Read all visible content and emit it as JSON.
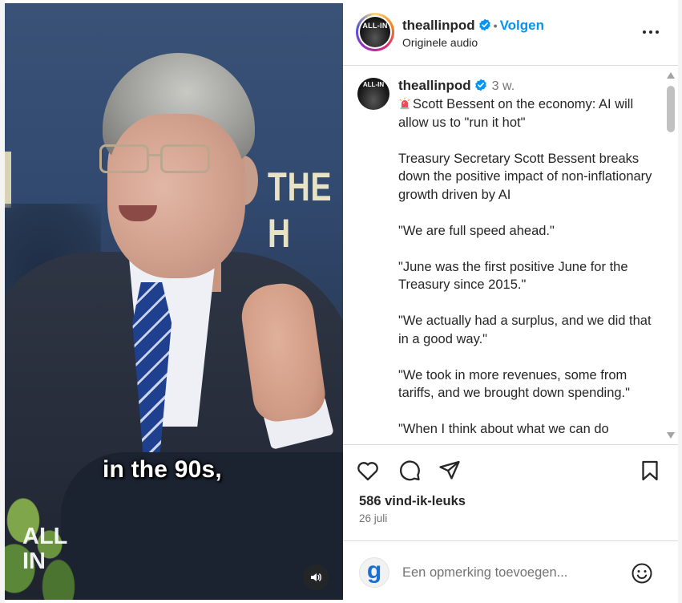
{
  "video": {
    "caption": "in the 90s,",
    "watermark_line1": "ALL",
    "watermark_line2": "IN",
    "backdrop_sign": "THE H"
  },
  "header": {
    "avatar_logo_text": "ALL-IN",
    "username": "theallinpod",
    "separator": "•",
    "follow_label": "Volgen",
    "audio_label": "Originele audio"
  },
  "post": {
    "avatar_logo_text": "ALL-IN",
    "username": "theallinpod",
    "time_ago": "3 w.",
    "paragraphs": [
      "Scott Bessent on the economy: AI will allow us to \"run it hot\"",
      "Treasury Secretary Scott Bessent breaks down the positive impact of non-inflationary growth driven by AI",
      "\"We are full speed ahead.\"",
      "\"June was the first positive June for the Treasury since 2015.\"",
      "\"We actually had a surplus, and we did that in a good way.\"",
      "\"We took in more revenues, some from tariffs, and we brought down spending.\"",
      "\"When I think about what we can do"
    ]
  },
  "actions": {
    "likes": "586 vind-ik-leuks",
    "date": "26 juli"
  },
  "comment_box": {
    "avatar_letter": "g",
    "placeholder": "Een opmerking toevoegen..."
  },
  "colors": {
    "accent": "#0095f6",
    "text": "#262626",
    "muted": "#737373",
    "divider": "#dbdbdb"
  },
  "icons": {
    "verified": "verified-badge-icon",
    "more": "more-options-icon",
    "like": "heart-icon",
    "comment": "comment-icon",
    "share": "share-icon",
    "save": "bookmark-icon",
    "emoji": "emoji-icon",
    "mute": "audio-icon"
  }
}
